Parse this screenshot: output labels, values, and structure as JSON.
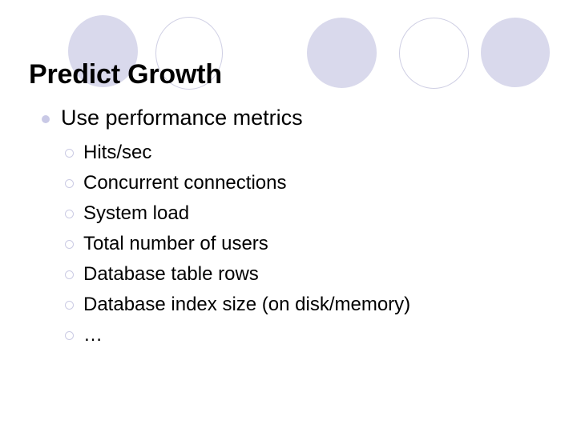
{
  "slide": {
    "title": "Predict Growth",
    "background_color": "#FFFFFF",
    "text_color": "#000000",
    "accent_color": "#D9D9EC",
    "bullet_marker_color": "#C9C9E6"
  },
  "decoration": {
    "circles": [
      {
        "name": "deco-circle-1",
        "style": "filled"
      },
      {
        "name": "deco-circle-2",
        "style": "outlined"
      },
      {
        "name": "deco-circle-3",
        "style": "filled"
      },
      {
        "name": "deco-circle-4",
        "style": "outlined"
      },
      {
        "name": "deco-circle-5",
        "style": "filled"
      }
    ]
  },
  "content": {
    "level1": {
      "text": "Use performance metrics",
      "marker": "filled-disc-bullet"
    },
    "level2": [
      {
        "text": "Hits/sec",
        "marker": "hollow-ring-bullet"
      },
      {
        "text": "Concurrent connections",
        "marker": "hollow-ring-bullet"
      },
      {
        "text": "System load",
        "marker": "hollow-ring-bullet"
      },
      {
        "text": "Total number of users",
        "marker": "hollow-ring-bullet"
      },
      {
        "text": "Database table rows",
        "marker": "hollow-ring-bullet"
      },
      {
        "text": "Database index size (on disk/memory)",
        "marker": "hollow-ring-bullet"
      },
      {
        "text": "…",
        "marker": "hollow-ring-bullet"
      }
    ]
  }
}
